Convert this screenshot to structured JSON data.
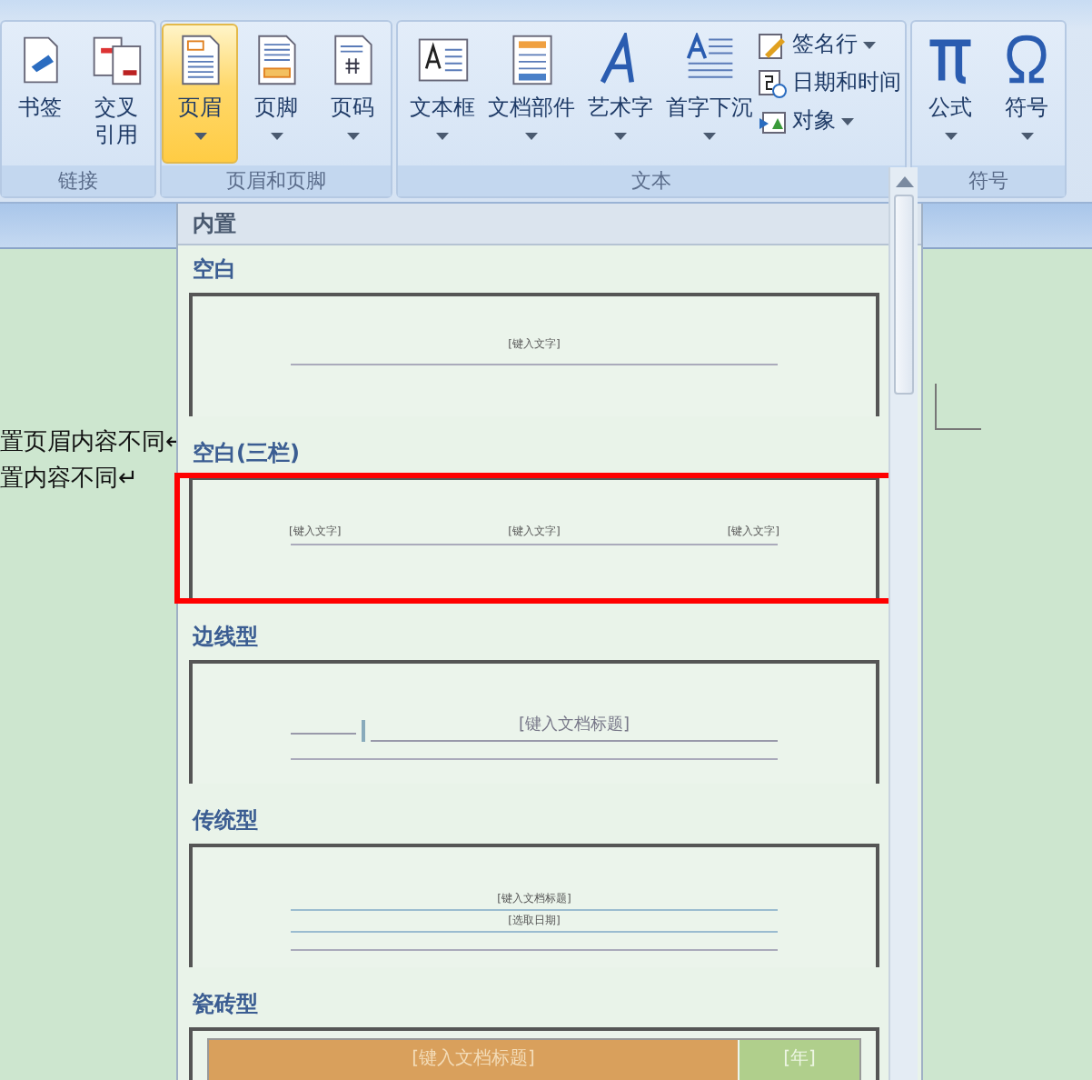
{
  "ribbon": {
    "groups": [
      {
        "label": "链接",
        "buttons": [
          {
            "kind": "bookmark",
            "label": "书签",
            "dropdown": false,
            "selected": false
          },
          {
            "kind": "crossref",
            "label": "交叉引用",
            "dropdown": false,
            "selected": false
          }
        ]
      },
      {
        "label": "页眉和页脚",
        "buttons": [
          {
            "kind": "header",
            "label": "页眉",
            "dropdown": true,
            "selected": true
          },
          {
            "kind": "footer",
            "label": "页脚",
            "dropdown": true,
            "selected": false
          },
          {
            "kind": "pagenum",
            "label": "页码",
            "dropdown": true,
            "selected": false
          }
        ]
      },
      {
        "label": "文本",
        "buttons": [
          {
            "kind": "textbox",
            "label": "文本框",
            "dropdown": true,
            "selected": false
          },
          {
            "kind": "parts",
            "label": "文档部件",
            "dropdown": true,
            "selected": false
          },
          {
            "kind": "wordart",
            "label": "艺术字",
            "dropdown": true,
            "selected": false
          },
          {
            "kind": "dropcap",
            "label": "首字下沉",
            "dropdown": true,
            "selected": false
          }
        ],
        "small_buttons": [
          {
            "kind": "signature",
            "label": "签名行",
            "dropdown": true
          },
          {
            "kind": "datetime",
            "label": "日期和时间",
            "dropdown": false
          },
          {
            "kind": "object",
            "label": "对象",
            "dropdown": true
          }
        ]
      },
      {
        "label": "符号",
        "buttons": [
          {
            "kind": "equation",
            "label": "公式",
            "dropdown": true,
            "selected": false
          },
          {
            "kind": "symbol",
            "label": "符号",
            "dropdown": true,
            "selected": false
          }
        ]
      }
    ]
  },
  "document": {
    "lines": [
      "置页眉内容不同↵",
      "置内容不同↵"
    ]
  },
  "gallery": {
    "header": "内置",
    "items": [
      {
        "kind": "blank",
        "title": "空白",
        "texts": [
          "[键入文字]"
        ],
        "highlighted": false
      },
      {
        "kind": "three",
        "title": "空白(三栏)",
        "texts": [
          "[键入文字]",
          "[键入文字]",
          "[键入文字]"
        ],
        "highlighted": true
      },
      {
        "kind": "sideline",
        "title": "边线型",
        "texts": [
          "[键入文档标题]"
        ],
        "highlighted": false
      },
      {
        "kind": "traditional",
        "title": "传统型",
        "texts": [
          "[键入文档标题]",
          "[选取日期]"
        ],
        "highlighted": false
      },
      {
        "kind": "tiles",
        "title": "瓷砖型",
        "texts": [
          "[键入文档标题]",
          "[年]"
        ]
      }
    ]
  }
}
